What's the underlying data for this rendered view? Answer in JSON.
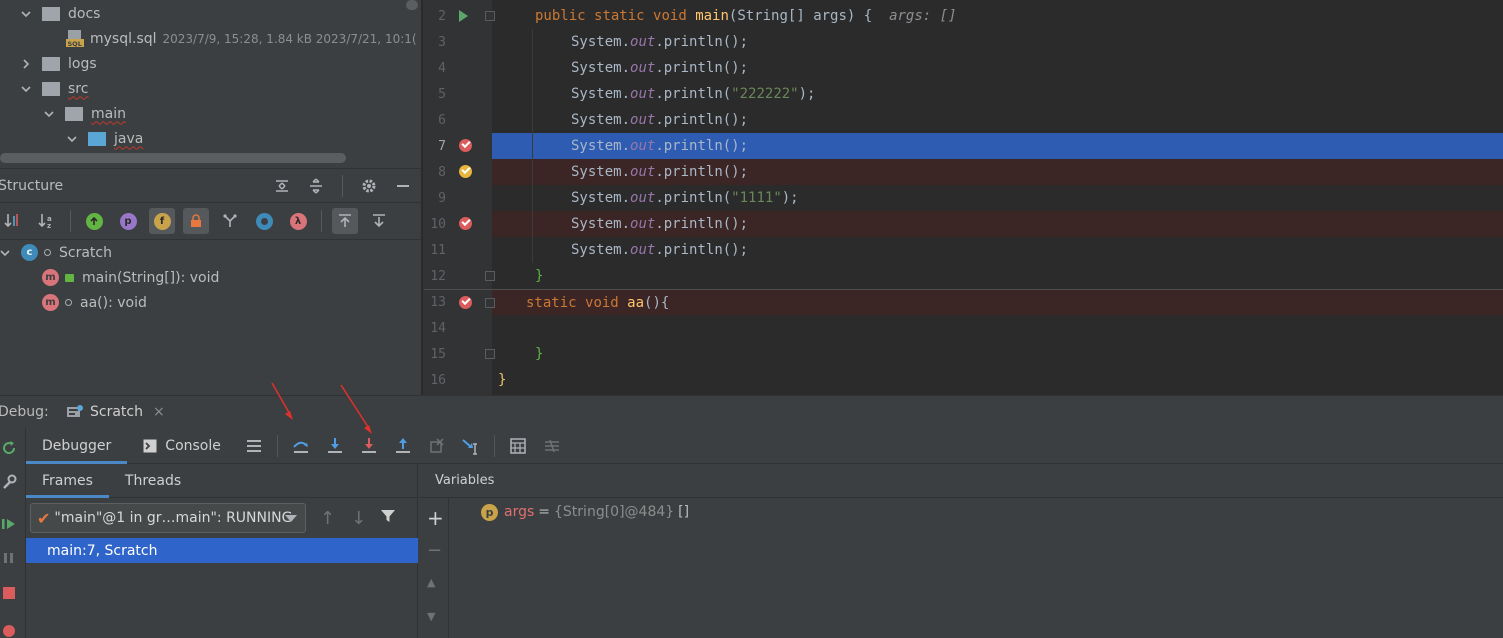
{
  "project_tree": {
    "items": [
      {
        "label": "docs",
        "type": "folder",
        "expanded": true
      },
      {
        "label": "mysql.sql",
        "type": "file",
        "meta": "2023/7/9, 15:28, 1.84 kB 2023/7/21, 10:1("
      },
      {
        "label": "logs",
        "type": "folder",
        "expanded": false
      },
      {
        "label": "src",
        "type": "folder",
        "expanded": true
      },
      {
        "label": "main",
        "type": "folder",
        "expanded": true
      },
      {
        "label": "java",
        "type": "folder",
        "expanded": true
      }
    ],
    "sql_badge": "SQL"
  },
  "structure": {
    "title": "Structure",
    "toolbar_icons": [
      "sort-by-visibility-icon",
      "sort-alpha-icon",
      "show-inherited-icon",
      "show-properties-icon",
      "show-fields-icon",
      "show-non-public-icon",
      "show-lambdas-branch-icon",
      "show-anonymous-icon",
      "show-lambdas-icon",
      "autoscroll-to-source-icon",
      "autoscroll-from-source-icon"
    ],
    "toolbar_letters": {
      "p": "p",
      "f": "f",
      "lambda": "λ"
    },
    "class_badge": "c",
    "method_badge": "m",
    "items": [
      {
        "label": "Scratch",
        "kind": "class"
      },
      {
        "label": "main(String[]): void",
        "kind": "method",
        "visibility": "public"
      },
      {
        "label": "aa(): void",
        "kind": "method",
        "visibility": "package"
      }
    ]
  },
  "editor": {
    "lines": [
      {
        "num": "2"
      },
      {
        "num": "3"
      },
      {
        "num": "4"
      },
      {
        "num": "5"
      },
      {
        "num": "6"
      },
      {
        "num": "7"
      },
      {
        "num": "8"
      },
      {
        "num": "9"
      },
      {
        "num": "10"
      },
      {
        "num": "11"
      },
      {
        "num": "12"
      },
      {
        "num": "13"
      },
      {
        "num": "14"
      },
      {
        "num": "15"
      },
      {
        "num": "16"
      }
    ],
    "tokens": {
      "public": "public",
      "static": "static",
      "void": "void",
      "main": "main",
      "main_params": "(String[] args) {",
      "args_hint": "args: []",
      "system": "System.",
      "out": "out",
      "println": ".println(",
      "close_empty": ");",
      "str_222222": "\"222222\"",
      "str_1111": "\"1111\"",
      "brace_close": "}",
      "aa": "aa",
      "aa_params": "(){"
    },
    "colors": {
      "keyword": "#cc7832",
      "function": "#ffc66d",
      "field": "#9876aa",
      "string": "#6a8759",
      "exec_line": "#2f65ca",
      "breakpoint_line": "#3b2525"
    }
  },
  "debug": {
    "label": "Debug:",
    "tab": "Scratch",
    "tab_close": "×",
    "tabs": {
      "debugger": "Debugger",
      "console": "Console"
    },
    "frames_tabs": {
      "frames": "Frames",
      "threads": "Threads"
    },
    "thread_value": "\"main\"@1 in gr…main\": RUNNING",
    "selected_frame": "main:7, Scratch",
    "variables_title": "Variables",
    "variable": {
      "badge": "p",
      "name": "args",
      "eq": "=",
      "type": "{String[0]@484}",
      "value": "[]"
    },
    "var_side": {
      "add": "+",
      "remove": "−",
      "up": "▲",
      "down": "▼"
    }
  }
}
